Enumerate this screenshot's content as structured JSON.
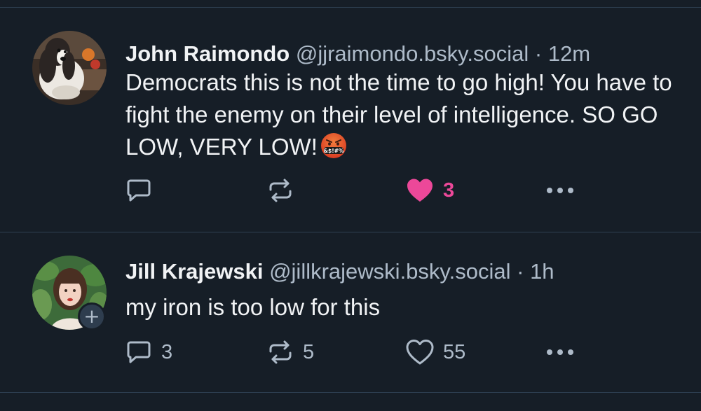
{
  "posts": [
    {
      "author": {
        "name": "John Raimondo",
        "handle": "@jjraimondo.bsky.social"
      },
      "separator": "·",
      "time": "12m",
      "text": "Democrats this is not the time to go high! You have to fight the enemy on their level of intelligence. SO GO LOW, VERY LOW!",
      "emoji": "face-with-symbols-on-mouth",
      "reply_count": "",
      "repost_count": "",
      "like_count": "3",
      "liked": true,
      "icons": {
        "reply": "reply-icon",
        "repost": "repost-icon",
        "like": "heart-icon",
        "more": "more-icon"
      }
    },
    {
      "author": {
        "name": "Jill Krajewski",
        "handle": "@jillkrajewski.bsky.social"
      },
      "separator": "·",
      "time": "1h",
      "text": "my iron is too low for this",
      "follow_badge": "+",
      "reply_count": "3",
      "repost_count": "5",
      "like_count": "55",
      "liked": false,
      "icons": {
        "reply": "reply-icon",
        "repost": "repost-icon",
        "like": "heart-icon",
        "more": "more-icon"
      }
    }
  ],
  "colors": {
    "background": "#161e27",
    "divider": "#2e4052",
    "text_primary": "#f1f3f5",
    "text_secondary": "#aebbc9",
    "like_active": "#ec4899"
  }
}
